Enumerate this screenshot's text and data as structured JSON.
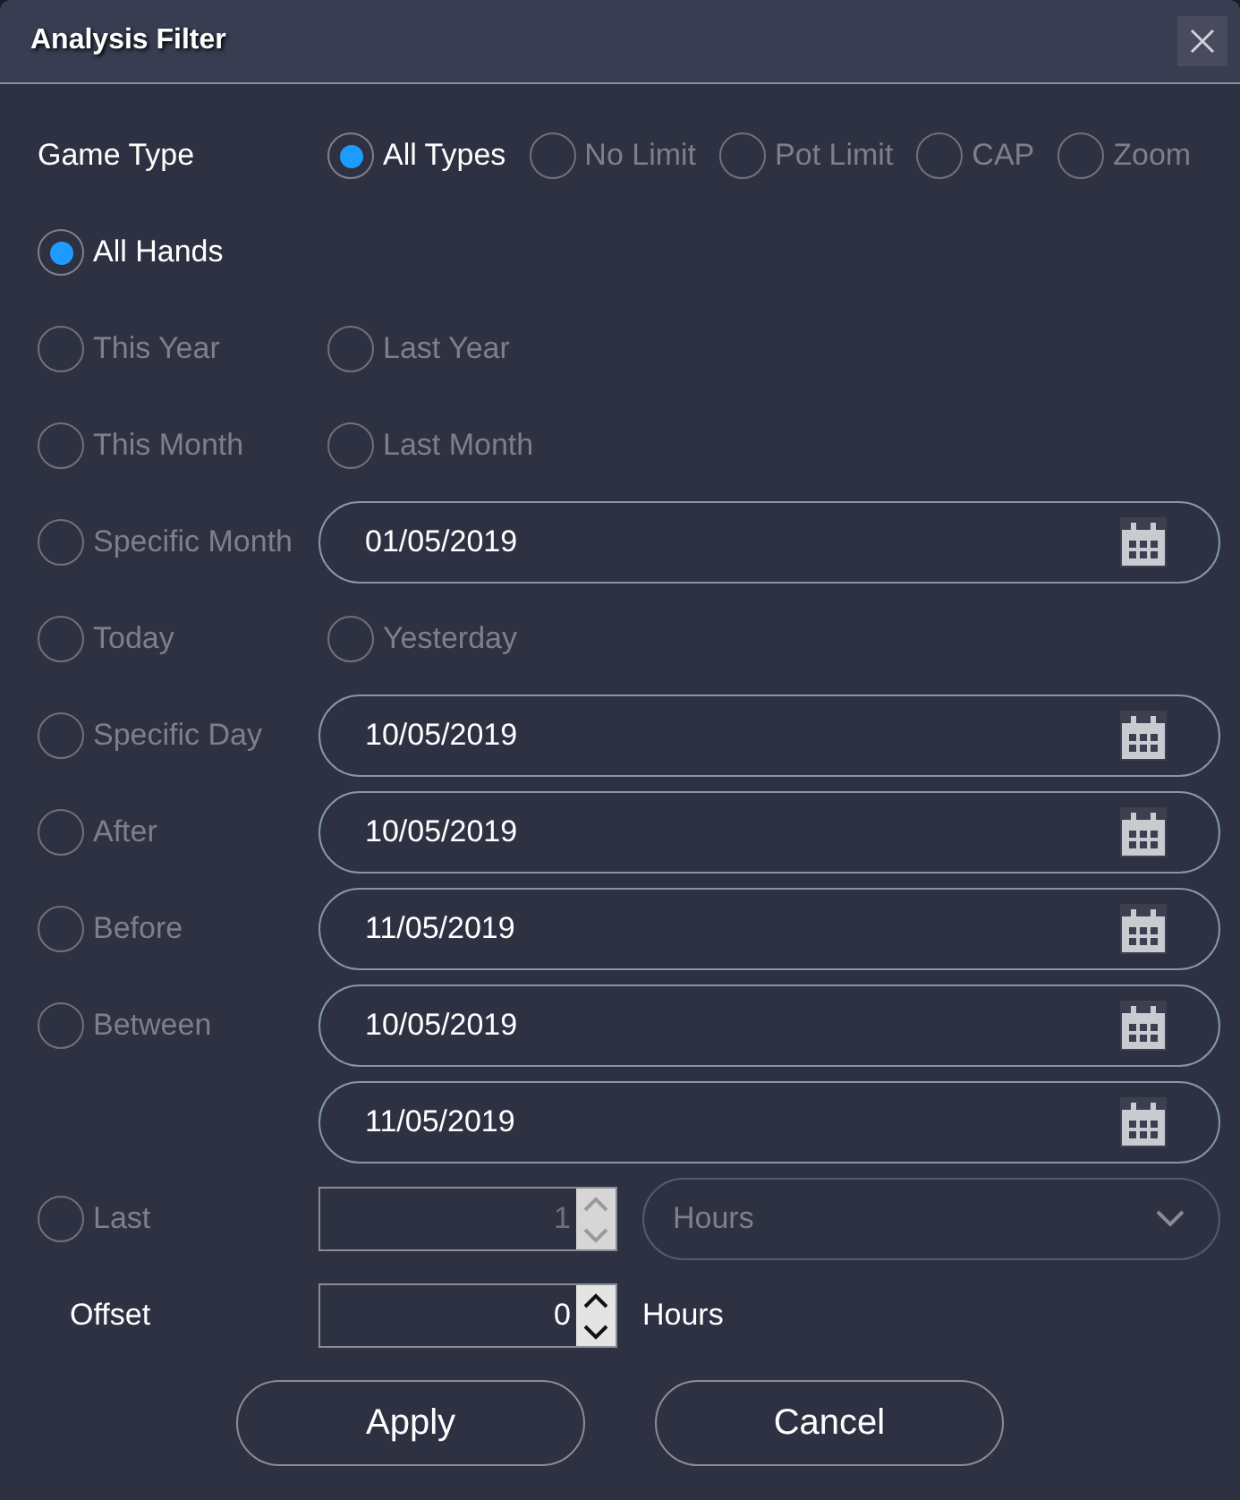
{
  "window": {
    "title": "Analysis Filter"
  },
  "game_type": {
    "label": "Game Type",
    "options": [
      {
        "label": "All Types",
        "selected": true
      },
      {
        "label": "No Limit",
        "selected": false
      },
      {
        "label": "Pot Limit",
        "selected": false
      },
      {
        "label": "CAP",
        "selected": false
      },
      {
        "label": "Zoom",
        "selected": false
      }
    ]
  },
  "range_rows": [
    {
      "kind": "radio",
      "options": [
        {
          "label": "All Hands",
          "selected": true
        }
      ]
    },
    {
      "kind": "radio",
      "options": [
        {
          "label": "This Year",
          "selected": false
        },
        {
          "label": "Last Year",
          "selected": false
        }
      ]
    },
    {
      "kind": "radio",
      "options": [
        {
          "label": "This Month",
          "selected": false
        },
        {
          "label": "Last Month",
          "selected": false
        }
      ]
    },
    {
      "kind": "date",
      "option": {
        "label": "Specific Month",
        "selected": false
      },
      "date": "01/05/2019"
    },
    {
      "kind": "radio",
      "options": [
        {
          "label": "Today",
          "selected": false
        },
        {
          "label": "Yesterday",
          "selected": false
        }
      ]
    },
    {
      "kind": "date",
      "option": {
        "label": "Specific Day",
        "selected": false
      },
      "date": "10/05/2019"
    },
    {
      "kind": "date",
      "option": {
        "label": "After",
        "selected": false
      },
      "date": "10/05/2019"
    },
    {
      "kind": "date",
      "option": {
        "label": "Before",
        "selected": false
      },
      "date": "11/05/2019"
    },
    {
      "kind": "date",
      "option": {
        "label": "Between",
        "selected": false
      },
      "date": "10/05/2019"
    },
    {
      "kind": "date",
      "date": "11/05/2019"
    },
    {
      "kind": "last",
      "option": {
        "label": "Last",
        "selected": false
      },
      "value": "1",
      "disabled": true,
      "unit": "Hours"
    }
  ],
  "offset": {
    "label": "Offset",
    "value": "0",
    "disabled": false,
    "unit": "Hours"
  },
  "buttons": [
    "Apply",
    "Cancel"
  ]
}
